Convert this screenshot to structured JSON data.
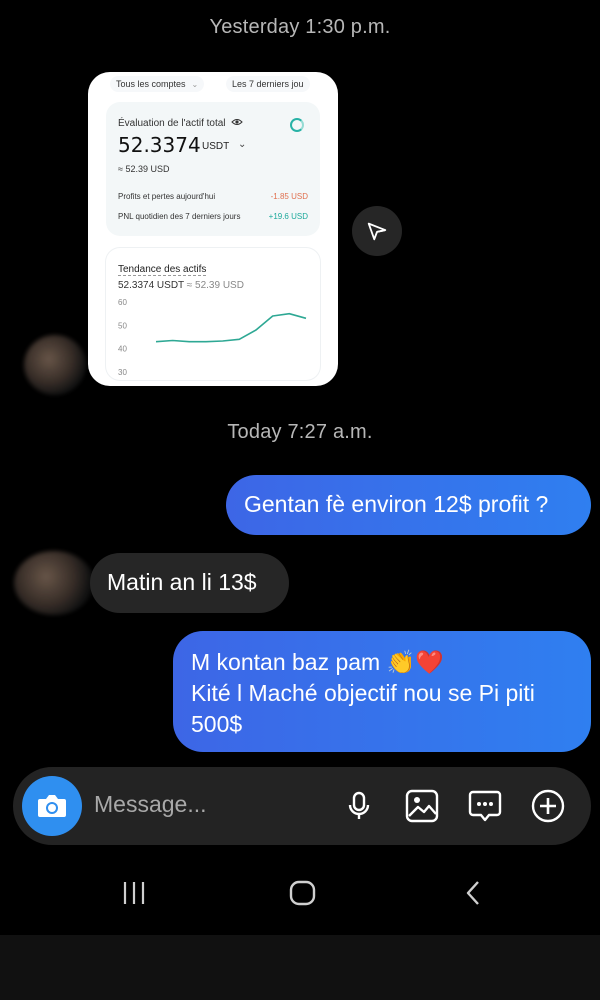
{
  "chat": {
    "timestamp_yesterday": "Yesterday 1:30 p.m.",
    "timestamp_today": "Today 7:27 a.m.",
    "messages": [
      {
        "side": "sent",
        "text": "Gentan fè environ 12$ profit ?"
      },
      {
        "side": "received",
        "text": "Matin an li 13$"
      },
      {
        "side": "sent",
        "line1": "M kontan baz pam 👏❤️",
        "line2": "Kité l Maché objectif nou se Pi piti",
        "line3": "500$"
      }
    ]
  },
  "screenshot": {
    "filter_accounts": "Tous les comptes",
    "filter_period": "Les 7 derniers jou",
    "asset_label": "Évaluation de l'actif total",
    "total_value": "52.3374",
    "total_unit": "USDT",
    "approx_usd": "≈ 52.39 USD",
    "pnl_today_label": "Profits et pertes aujourd'hui",
    "pnl_today_value": "-1.85 USD",
    "pnl_7d_label": "PNL quotidien des 7 derniers jours",
    "pnl_7d_value": "+19.6 USD",
    "trend_title": "Tendance des actifs",
    "trend_value": "52.3374 USDT",
    "trend_approx": "≈ 52.39 USD",
    "axis_ticks": [
      "60",
      "50",
      "40",
      "30"
    ],
    "chart_data": {
      "type": "line",
      "series": [
        {
          "values": [
            43,
            43.5,
            43,
            43,
            43.3,
            44,
            48,
            54,
            55,
            53
          ]
        }
      ],
      "ylim": [
        30,
        60
      ]
    }
  },
  "input": {
    "placeholder": "Message..."
  },
  "colors": {
    "sent_bubble": "#3a72ea",
    "received_bubble": "#262626",
    "camera_button": "#2f8ff0",
    "chart_line": "#2ea894",
    "negative": "#e0704f",
    "positive": "#1ca99b"
  },
  "icons": [
    "share-icon",
    "camera-icon",
    "microphone-icon",
    "gallery-icon",
    "sticker-chat-icon",
    "plus-circle-icon",
    "nav-recents-icon",
    "nav-home-icon",
    "nav-back-icon"
  ]
}
